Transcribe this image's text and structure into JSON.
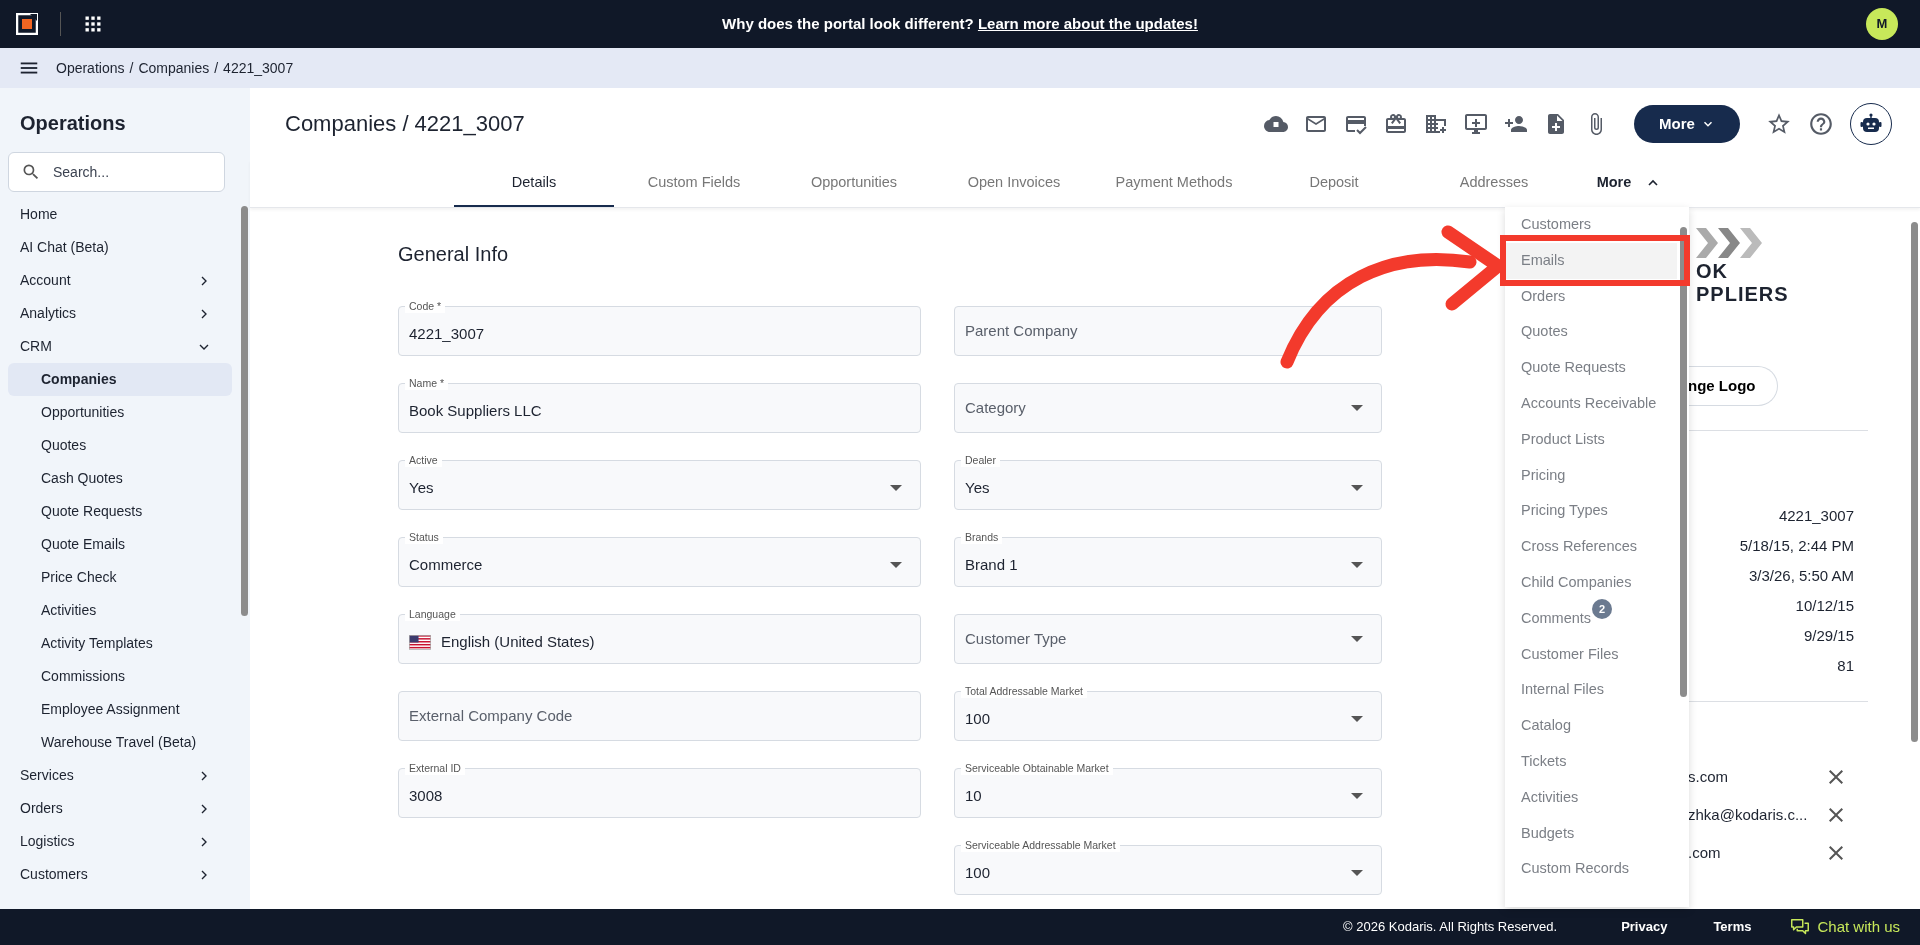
{
  "banner": {
    "text": "Why does the portal look different?",
    "link": "Learn more about the updates!"
  },
  "user": {
    "initial": "M"
  },
  "breadcrumb": {
    "separator": "/",
    "items": [
      "Operations",
      "Companies",
      "4221_3007"
    ]
  },
  "sidebar": {
    "title": "Operations",
    "search": {
      "placeholder": "Search..."
    },
    "items": [
      {
        "label": "Home",
        "selected": false
      },
      {
        "label": "AI Chat (Beta)",
        "selected": false
      },
      {
        "label": "Account",
        "selected": false,
        "expanded": false
      },
      {
        "label": "Analytics",
        "selected": false,
        "expanded": false
      },
      {
        "label": "CRM",
        "selected": false,
        "expanded": true,
        "children": [
          {
            "label": "Companies",
            "selected": true
          },
          {
            "label": "Opportunities",
            "selected": false
          },
          {
            "label": "Quotes",
            "selected": false
          },
          {
            "label": "Cash Quotes",
            "selected": false
          },
          {
            "label": "Quote Requests",
            "selected": false
          },
          {
            "label": "Quote Emails",
            "selected": false
          },
          {
            "label": "Price Check",
            "selected": false
          },
          {
            "label": "Activities",
            "selected": false
          },
          {
            "label": "Activity Templates",
            "selected": false
          },
          {
            "label": "Commissions",
            "selected": false
          },
          {
            "label": "Employee Assignment",
            "selected": false
          },
          {
            "label": "Warehouse Travel (Beta)",
            "selected": false
          }
        ]
      },
      {
        "label": "Services",
        "selected": false,
        "expanded": false
      },
      {
        "label": "Orders",
        "selected": false,
        "expanded": false
      },
      {
        "label": "Logistics",
        "selected": false,
        "expanded": false
      },
      {
        "label": "Customers",
        "selected": false,
        "expanded": false
      }
    ]
  },
  "page": {
    "title": "Companies / 4221_3007",
    "more_button": "More"
  },
  "tabs": [
    {
      "label": "Details",
      "selected": true
    },
    {
      "label": "Custom Fields",
      "selected": false
    },
    {
      "label": "Opportunities",
      "selected": false
    },
    {
      "label": "Open Invoices",
      "selected": false
    },
    {
      "label": "Payment Methods",
      "selected": false
    },
    {
      "label": "Deposit",
      "selected": false
    },
    {
      "label": "Addresses",
      "selected": false
    },
    {
      "label": "More",
      "selected": false,
      "expanded": true
    }
  ],
  "more_menu": {
    "items": [
      {
        "label": "Customers",
        "selected": false
      },
      {
        "label": "Emails",
        "selected": true
      },
      {
        "label": "Orders",
        "selected": false
      },
      {
        "label": "Quotes",
        "selected": false
      },
      {
        "label": "Quote Requests",
        "selected": false
      },
      {
        "label": "Accounts Receivable",
        "selected": false
      },
      {
        "label": "Product Lists",
        "selected": false
      },
      {
        "label": "Pricing",
        "selected": false
      },
      {
        "label": "Pricing Types",
        "selected": false
      },
      {
        "label": "Cross References",
        "selected": false
      },
      {
        "label": "Child Companies",
        "selected": false
      },
      {
        "label": "Comments",
        "selected": false,
        "badge": "2"
      },
      {
        "label": "Customer Files",
        "selected": false
      },
      {
        "label": "Internal Files",
        "selected": false
      },
      {
        "label": "Catalog",
        "selected": false
      },
      {
        "label": "Tickets",
        "selected": false
      },
      {
        "label": "Activities",
        "selected": false
      },
      {
        "label": "Budgets",
        "selected": false
      },
      {
        "label": "Custom Records",
        "selected": false
      }
    ]
  },
  "form": {
    "title": "General Info",
    "left": [
      {
        "kind": "text",
        "label": "Code *",
        "value": "4221_3007"
      },
      {
        "kind": "text",
        "label": "Name *",
        "value": "Book Suppliers LLC"
      },
      {
        "kind": "select",
        "label": "Active",
        "value": "Yes"
      },
      {
        "kind": "select",
        "label": "Status",
        "value": "Commerce"
      },
      {
        "kind": "language",
        "label": "Language",
        "value": "English (United States)"
      },
      {
        "kind": "text",
        "placeholder": "External Company Code"
      },
      {
        "kind": "text",
        "label": "External ID",
        "value": "3008"
      }
    ],
    "right": [
      {
        "kind": "text",
        "placeholder": "Parent Company"
      },
      {
        "kind": "select",
        "placeholder": "Category"
      },
      {
        "kind": "select",
        "label": "Dealer",
        "value": "Yes"
      },
      {
        "kind": "select",
        "label": "Brands",
        "value": "Brand 1"
      },
      {
        "kind": "select",
        "placeholder": "Customer Type"
      },
      {
        "kind": "select",
        "label": "Total Addressable Market",
        "value": "100"
      },
      {
        "kind": "select",
        "label": "Serviceable Obtainable Market",
        "value": "10"
      },
      {
        "kind": "select",
        "label": "Serviceable Addressable Market",
        "value": "100"
      }
    ]
  },
  "side_panel": {
    "logo_lines": [
      "OK",
      "PPLIERS"
    ],
    "logo_button": "nge Logo",
    "values": [
      "4221_3007",
      "5/18/15, 2:44 PM",
      "3/3/26, 5:50 AM",
      "10/12/15",
      "9/29/15",
      "81"
    ],
    "emails": [
      "s.com",
      "zhka@kodaris.c...",
      ".com"
    ]
  },
  "footer": {
    "copyright": "© 2026 Kodaris. All Rights Reserved.",
    "links": [
      "Privacy",
      "Terms"
    ],
    "chat": "Chat with us"
  }
}
